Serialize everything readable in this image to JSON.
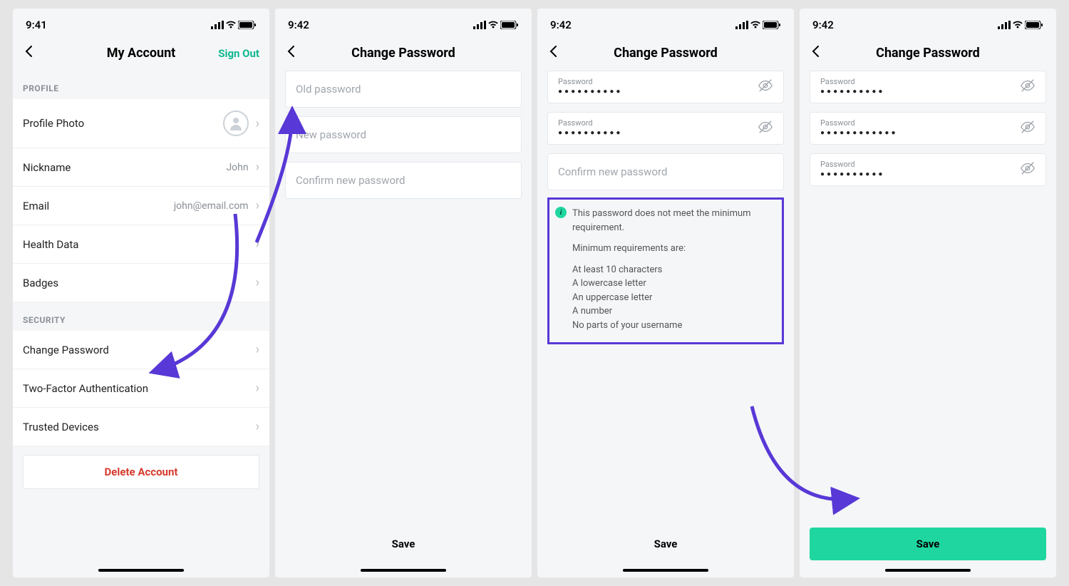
{
  "screen1": {
    "time": "9:41",
    "title": "My Account",
    "signOut": "Sign Out",
    "sections": {
      "profile": {
        "header": "PROFILE",
        "items": {
          "profilePhoto": "Profile Photo",
          "nickname": "Nickname",
          "nicknameValue": "John",
          "email": "Email",
          "emailValue": "john@email.com",
          "healthData": "Health Data",
          "badges": "Badges"
        }
      },
      "security": {
        "header": "SECURITY",
        "items": {
          "changePassword": "Change Password",
          "twoFactor": "Two-Factor Authentication",
          "trustedDevices": "Trusted Devices"
        }
      }
    },
    "deleteAccount": "Delete Account"
  },
  "screen2": {
    "time": "9:42",
    "title": "Change Password",
    "fields": {
      "old": "Old password",
      "new": "New password",
      "confirm": "Confirm new password"
    },
    "save": "Save"
  },
  "screen3": {
    "time": "9:42",
    "title": "Change Password",
    "fieldLabel": "Password",
    "dots": "●●●●●●●●●●",
    "confirmPlaceholder": "Confirm new password",
    "info": {
      "line1": "This password does not meet the minimum requirement.",
      "line2": "Minimum requirements are:",
      "req1": "At least 10 characters",
      "req2": "A lowercase letter",
      "req3": "An uppercase letter",
      "req4": "A number",
      "req5": "No parts of your username"
    },
    "save": "Save"
  },
  "screen4": {
    "time": "9:42",
    "title": "Change Password",
    "fieldLabel": "Password",
    "dots10": "●●●●●●●●●●",
    "dots12": "●●●●●●●●●●●●",
    "save": "Save"
  }
}
